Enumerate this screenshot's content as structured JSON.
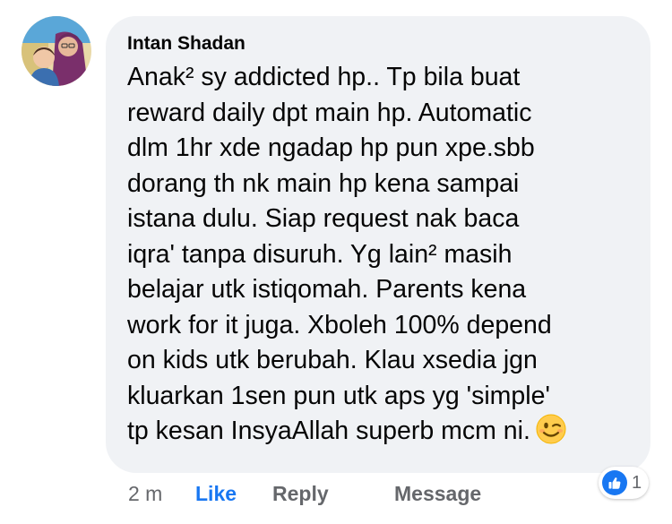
{
  "comment": {
    "author": "Intan Shadan",
    "text": "Anak² sy addicted hp.. Tp bila buat\nreward daily dpt main hp. Automatic\ndlm 1hr  xde ngadap hp pun xpe.sbb\ndorang th nk main hp kena sampai\nistana dulu. Siap request nak baca\niqra' tanpa disuruh. Yg lain² masih\nbelajar utk istiqomah. Parents kena\nwork for it juga. Xboleh 100% depend\non kids utk berubah. Klau xsedia jgn\nkluarkan 1sen pun utk aps yg 'simple'\ntp kesan InsyaAllah superb mcm ni.",
    "emoji": "wink-emoji"
  },
  "actions": {
    "timestamp": "2 m",
    "like_label": "Like",
    "reply_label": "Reply",
    "message_label": "Message"
  },
  "reactions": {
    "type": "like",
    "count": "1"
  },
  "colors": {
    "bubble": "#f0f2f5",
    "accent": "#1877f2",
    "secondary_text": "#65676b"
  }
}
